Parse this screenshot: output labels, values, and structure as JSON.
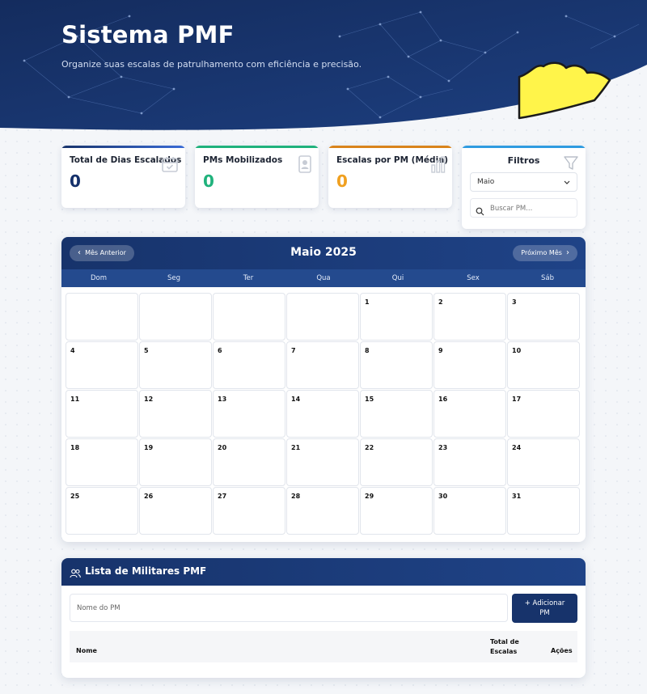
{
  "header": {
    "title": "Sistema PMF",
    "subtitle": "Organize suas escalas de patrulhamento com eficiência e precisão."
  },
  "stats": [
    {
      "label": "Total de Dias Escalados",
      "value": "0",
      "color": "#14306a",
      "icon": "calendar-check-icon"
    },
    {
      "label": "PMs Mobilizados",
      "value": "0",
      "color": "#20b27c",
      "icon": "id-badge-icon"
    },
    {
      "label": "Escalas por PM (Média)",
      "value": "0",
      "color": "#f0a020",
      "icon": "bar-chart-icon"
    }
  ],
  "filters": {
    "title": "Filtros",
    "month_selected": "Maio",
    "search_placeholder": "Buscar PM..."
  },
  "calendar": {
    "title": "Maio 2025",
    "prev_label": "Mês Anterior",
    "next_label": "Próximo Mês",
    "weekdays": [
      "Dom",
      "Seg",
      "Ter",
      "Qua",
      "Qui",
      "Sex",
      "Sáb"
    ],
    "first_weekday": 4,
    "days_in_month": 31
  },
  "military_list": {
    "title": "Lista de Militares PMF",
    "name_placeholder": "Nome do PM",
    "add_label_line1": "+ Adicionar",
    "add_label_line2": "PM",
    "columns": {
      "name": "Nome",
      "total_line1": "Total de",
      "total_line2": "Escalas",
      "actions": "Ações"
    }
  },
  "colors": {
    "primary": "#17336b",
    "accent_yellow": "#fff44a"
  }
}
